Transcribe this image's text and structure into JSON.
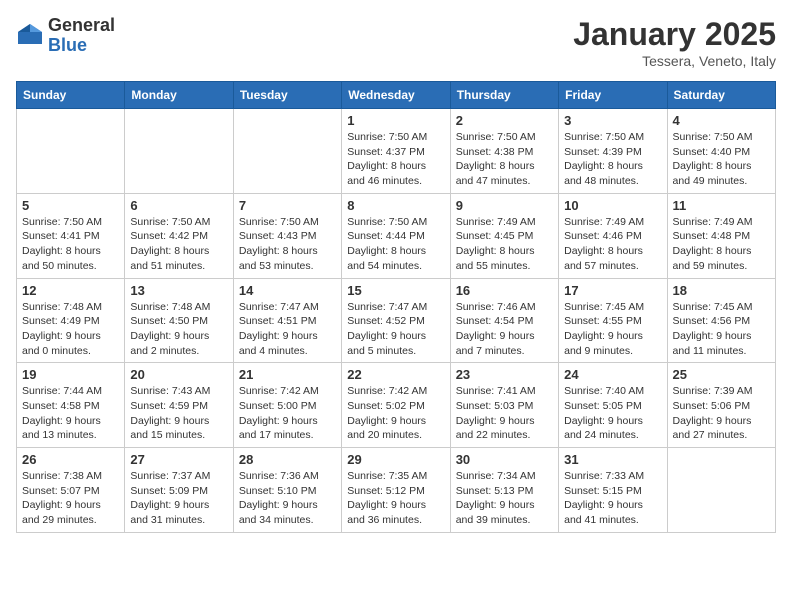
{
  "header": {
    "logo": {
      "general": "General",
      "blue": "Blue"
    },
    "title": "January 2025",
    "subtitle": "Tessera, Veneto, Italy"
  },
  "calendar": {
    "days_of_week": [
      "Sunday",
      "Monday",
      "Tuesday",
      "Wednesday",
      "Thursday",
      "Friday",
      "Saturday"
    ],
    "weeks": [
      [
        {
          "day": "",
          "info": ""
        },
        {
          "day": "",
          "info": ""
        },
        {
          "day": "",
          "info": ""
        },
        {
          "day": "1",
          "info": "Sunrise: 7:50 AM\nSunset: 4:37 PM\nDaylight: 8 hours and 46 minutes."
        },
        {
          "day": "2",
          "info": "Sunrise: 7:50 AM\nSunset: 4:38 PM\nDaylight: 8 hours and 47 minutes."
        },
        {
          "day": "3",
          "info": "Sunrise: 7:50 AM\nSunset: 4:39 PM\nDaylight: 8 hours and 48 minutes."
        },
        {
          "day": "4",
          "info": "Sunrise: 7:50 AM\nSunset: 4:40 PM\nDaylight: 8 hours and 49 minutes."
        }
      ],
      [
        {
          "day": "5",
          "info": "Sunrise: 7:50 AM\nSunset: 4:41 PM\nDaylight: 8 hours and 50 minutes."
        },
        {
          "day": "6",
          "info": "Sunrise: 7:50 AM\nSunset: 4:42 PM\nDaylight: 8 hours and 51 minutes."
        },
        {
          "day": "7",
          "info": "Sunrise: 7:50 AM\nSunset: 4:43 PM\nDaylight: 8 hours and 53 minutes."
        },
        {
          "day": "8",
          "info": "Sunrise: 7:50 AM\nSunset: 4:44 PM\nDaylight: 8 hours and 54 minutes."
        },
        {
          "day": "9",
          "info": "Sunrise: 7:49 AM\nSunset: 4:45 PM\nDaylight: 8 hours and 55 minutes."
        },
        {
          "day": "10",
          "info": "Sunrise: 7:49 AM\nSunset: 4:46 PM\nDaylight: 8 hours and 57 minutes."
        },
        {
          "day": "11",
          "info": "Sunrise: 7:49 AM\nSunset: 4:48 PM\nDaylight: 8 hours and 59 minutes."
        }
      ],
      [
        {
          "day": "12",
          "info": "Sunrise: 7:48 AM\nSunset: 4:49 PM\nDaylight: 9 hours and 0 minutes."
        },
        {
          "day": "13",
          "info": "Sunrise: 7:48 AM\nSunset: 4:50 PM\nDaylight: 9 hours and 2 minutes."
        },
        {
          "day": "14",
          "info": "Sunrise: 7:47 AM\nSunset: 4:51 PM\nDaylight: 9 hours and 4 minutes."
        },
        {
          "day": "15",
          "info": "Sunrise: 7:47 AM\nSunset: 4:52 PM\nDaylight: 9 hours and 5 minutes."
        },
        {
          "day": "16",
          "info": "Sunrise: 7:46 AM\nSunset: 4:54 PM\nDaylight: 9 hours and 7 minutes."
        },
        {
          "day": "17",
          "info": "Sunrise: 7:45 AM\nSunset: 4:55 PM\nDaylight: 9 hours and 9 minutes."
        },
        {
          "day": "18",
          "info": "Sunrise: 7:45 AM\nSunset: 4:56 PM\nDaylight: 9 hours and 11 minutes."
        }
      ],
      [
        {
          "day": "19",
          "info": "Sunrise: 7:44 AM\nSunset: 4:58 PM\nDaylight: 9 hours and 13 minutes."
        },
        {
          "day": "20",
          "info": "Sunrise: 7:43 AM\nSunset: 4:59 PM\nDaylight: 9 hours and 15 minutes."
        },
        {
          "day": "21",
          "info": "Sunrise: 7:42 AM\nSunset: 5:00 PM\nDaylight: 9 hours and 17 minutes."
        },
        {
          "day": "22",
          "info": "Sunrise: 7:42 AM\nSunset: 5:02 PM\nDaylight: 9 hours and 20 minutes."
        },
        {
          "day": "23",
          "info": "Sunrise: 7:41 AM\nSunset: 5:03 PM\nDaylight: 9 hours and 22 minutes."
        },
        {
          "day": "24",
          "info": "Sunrise: 7:40 AM\nSunset: 5:05 PM\nDaylight: 9 hours and 24 minutes."
        },
        {
          "day": "25",
          "info": "Sunrise: 7:39 AM\nSunset: 5:06 PM\nDaylight: 9 hours and 27 minutes."
        }
      ],
      [
        {
          "day": "26",
          "info": "Sunrise: 7:38 AM\nSunset: 5:07 PM\nDaylight: 9 hours and 29 minutes."
        },
        {
          "day": "27",
          "info": "Sunrise: 7:37 AM\nSunset: 5:09 PM\nDaylight: 9 hours and 31 minutes."
        },
        {
          "day": "28",
          "info": "Sunrise: 7:36 AM\nSunset: 5:10 PM\nDaylight: 9 hours and 34 minutes."
        },
        {
          "day": "29",
          "info": "Sunrise: 7:35 AM\nSunset: 5:12 PM\nDaylight: 9 hours and 36 minutes."
        },
        {
          "day": "30",
          "info": "Sunrise: 7:34 AM\nSunset: 5:13 PM\nDaylight: 9 hours and 39 minutes."
        },
        {
          "day": "31",
          "info": "Sunrise: 7:33 AM\nSunset: 5:15 PM\nDaylight: 9 hours and 41 minutes."
        },
        {
          "day": "",
          "info": ""
        }
      ]
    ]
  }
}
